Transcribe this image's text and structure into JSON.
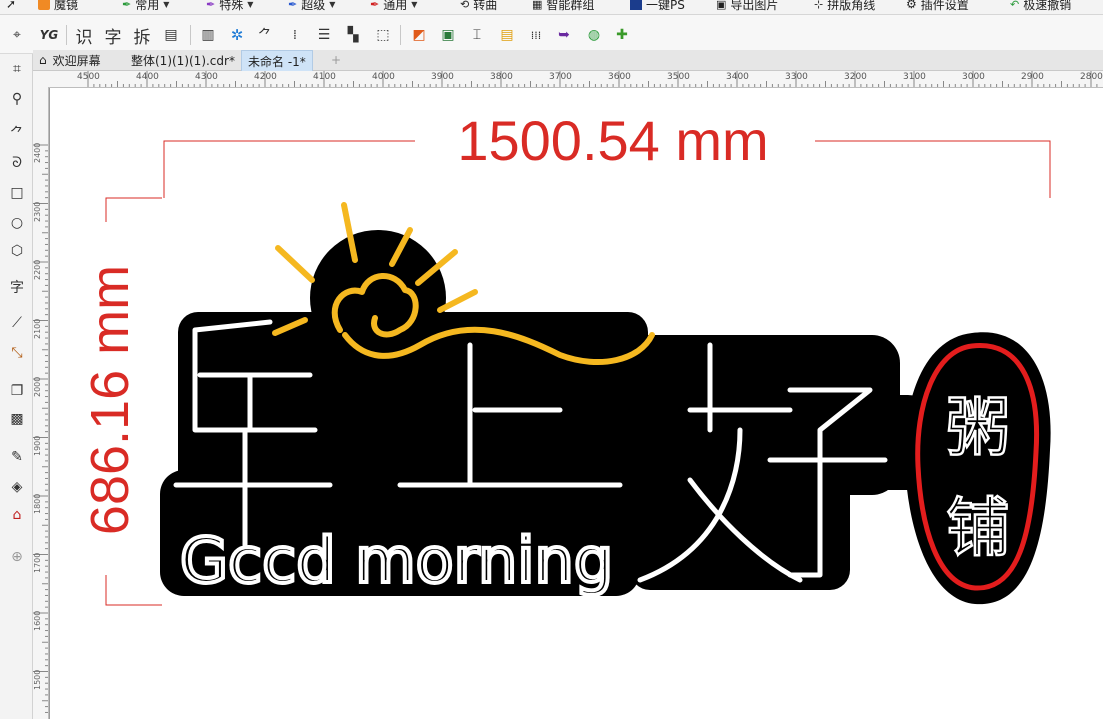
{
  "menubar": {
    "items": [
      {
        "label": "魔镜",
        "icon": "magic-mirror-icon"
      },
      {
        "label": "常用",
        "icon": "pen-icon"
      },
      {
        "label": "特殊",
        "icon": "pen-icon"
      },
      {
        "label": "超级",
        "icon": "pen-icon"
      },
      {
        "label": "通用",
        "icon": "pen-icon"
      },
      {
        "label": "转曲",
        "icon": "curve-icon"
      },
      {
        "label": "智能群组",
        "icon": "group-icon"
      },
      {
        "label": "一键PS",
        "icon": "ps-icon"
      },
      {
        "label": "导出图片",
        "icon": "image-icon"
      },
      {
        "label": "拼版角线",
        "icon": "crop-marks-icon"
      },
      {
        "label": "插件设置",
        "icon": "gear-icon"
      },
      {
        "label": "极速撤销",
        "icon": "undo-icon"
      }
    ]
  },
  "toolbar2": {
    "text_buttons": [
      "识",
      "字",
      "拆"
    ],
    "yg_label": "YG"
  },
  "tabs": [
    {
      "label": "欢迎屏幕"
    },
    {
      "label": "整体(1)(1)(1).cdr*"
    },
    {
      "label": "未命名 -1*"
    }
  ],
  "ruler": {
    "h_labels": [
      "4500",
      "4400",
      "4300",
      "4200",
      "4100",
      "4000",
      "3900",
      "3800",
      "3700",
      "3600",
      "3500",
      "3400",
      "3300",
      "3200",
      "3100",
      "3000",
      "2900",
      "2800"
    ],
    "v_labels": [
      "2400",
      "2300",
      "2200",
      "2100",
      "2000",
      "1900",
      "1800",
      "1700",
      "1600",
      "1500"
    ]
  },
  "artwork": {
    "width_dimension": "1500.54 mm",
    "height_dimension": "686.16 mm",
    "main_text": "早上好",
    "sub_text": "Gccd morning",
    "badge_text_1": "粥",
    "badge_text_2": "铺"
  },
  "colors": {
    "dimension_red": "#d92b25",
    "sun_yellow": "#f5b820",
    "badge_red": "#e31d1d",
    "artwork_black": "#000000"
  }
}
